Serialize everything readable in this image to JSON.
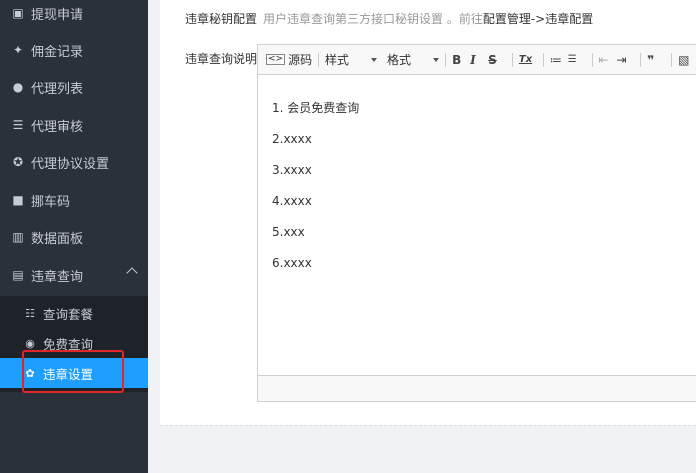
{
  "sidebar": {
    "items": [
      {
        "label": "提现申请",
        "icon": "withdraw-icon",
        "glyph": "▣"
      },
      {
        "label": "佣金记录",
        "icon": "commission-icon",
        "glyph": "✦"
      },
      {
        "label": "代理列表",
        "icon": "users-icon",
        "glyph": "●"
      },
      {
        "label": "代理审核",
        "icon": "audit-icon",
        "glyph": "☰"
      },
      {
        "label": "代理协议设置",
        "icon": "protocol-icon",
        "glyph": "✪"
      },
      {
        "label": "挪车码",
        "icon": "car-icon",
        "glyph": "■"
      },
      {
        "label": "数据面板",
        "icon": "chart-icon",
        "glyph": "▥"
      },
      {
        "label": "违章查询",
        "icon": "violation-icon",
        "glyph": "▤"
      }
    ],
    "submenu": [
      {
        "label": "查询套餐",
        "icon": "list-icon",
        "glyph": "☷"
      },
      {
        "label": "免费查询",
        "icon": "free-icon",
        "glyph": "◉"
      },
      {
        "label": "违章设置",
        "icon": "gear-icon",
        "glyph": "✿"
      }
    ]
  },
  "form": {
    "secret_label": "违章秘钥配置",
    "secret_hint": "用户违章查询第三方接口秘钥设置 。前往",
    "secret_link": "配置管理->违章配置",
    "desc_label": "违章查询说明"
  },
  "editor": {
    "toolbar": {
      "source": "源码",
      "style": "样式",
      "format": "格式",
      "buttons": [
        {
          "icon": "bold-icon",
          "glyph": "B"
        },
        {
          "icon": "italic-icon",
          "glyph": "I"
        },
        {
          "icon": "strike-icon",
          "glyph": "S"
        },
        {
          "icon": "clear-format-icon",
          "glyph": "Tx"
        },
        {
          "icon": "ordered-list-icon",
          "glyph": "≔"
        },
        {
          "icon": "bullet-list-icon",
          "glyph": "☰"
        },
        {
          "icon": "outdent-icon",
          "glyph": "⇤"
        },
        {
          "icon": "indent-icon",
          "glyph": "⇥"
        },
        {
          "icon": "quote-icon",
          "glyph": "❞"
        },
        {
          "icon": "image-icon",
          "glyph": "▧"
        }
      ]
    },
    "lines": [
      "1. 会员免费查询",
      "2.xxxx",
      "3.xxxx",
      "4.xxxx",
      "5.xxx",
      "6.xxxx"
    ]
  }
}
